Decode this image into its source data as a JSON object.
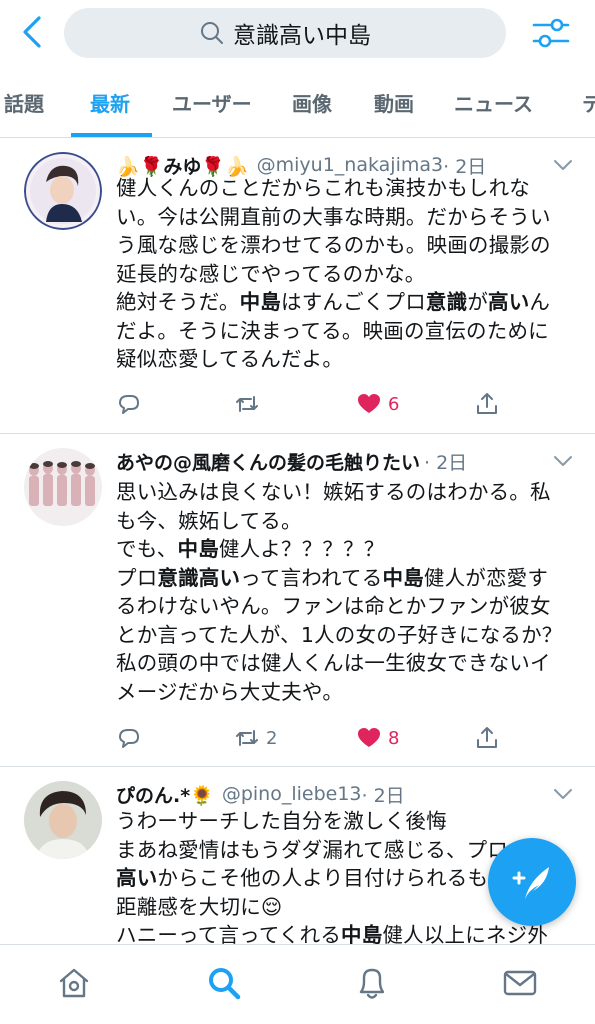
{
  "search": {
    "query": "意識高い中島"
  },
  "tabs": [
    {
      "label": "話題",
      "active": false
    },
    {
      "label": "最新",
      "active": true
    },
    {
      "label": "ユーザー",
      "active": false
    },
    {
      "label": "画像",
      "active": false
    },
    {
      "label": "動画",
      "active": false
    },
    {
      "label": "ニュース",
      "active": false
    },
    {
      "label": "テ",
      "active": false
    }
  ],
  "tweets": [
    {
      "name": "🍌🌹みゆ🌹🍌",
      "handle": "@miyu1_nakajima3",
      "time": "· 2日",
      "lines": [
        [
          "健人くんのことだからこれも演技かもしれな"
        ],
        [
          "い。今は公開直前の大事な時期。だからそうい"
        ],
        [
          "う風な感じを漂わせてるのかも。映画の撮影の"
        ],
        [
          "延長的な感じでやってるのかな。"
        ],
        [
          "絶対そうだ。",
          "中島",
          "はすんごくプロ",
          "意識",
          "が",
          "高い",
          "ん"
        ],
        [
          "だよ。そうに決まってる。映画の宣伝のために"
        ],
        [
          "疑似恋愛してるんだよ。"
        ]
      ],
      "reply_count": "",
      "retweet_count": "",
      "like_count": "6",
      "liked": true
    },
    {
      "name": "あやの@風磨くんの髪の毛触りたい",
      "handle": "",
      "time": "· 2日",
      "lines": [
        [
          "思い込みは良くない！嫉妬するのはわかる。私"
        ],
        [
          "も今、嫉妬してる。"
        ],
        [
          "でも、",
          "中島",
          "健人よ？？？？？"
        ],
        [
          "プロ",
          "意識高い",
          "って言われてる",
          "中島",
          "健人が恋愛す"
        ],
        [
          "るわけないやん。ファンは命とかファンが彼女"
        ],
        [
          "とか言ってた人が、1人の女の子好きになるか？"
        ],
        [
          "私の頭の中では健人くんは一生彼女できないイ"
        ],
        [
          "メージだから大丈夫や。"
        ]
      ],
      "reply_count": "",
      "retweet_count": "2",
      "like_count": "8",
      "liked": true
    },
    {
      "name": "ぴのん.*🌻",
      "handle": "@pino_liebe13",
      "time": "· 2日",
      "lines": [
        [
          "うわーサーチした自分を激しく後悔"
        ],
        [
          "まあね愛情はもうダダ漏れて感じる、プロ"
        ],
        [
          "高い",
          "からこそ他の人より目付けられるも"
        ],
        [
          "距離感を大切に😌"
        ],
        [
          "ハニーって言ってくれる",
          "中島",
          "健人以上にネジ外"
        ]
      ],
      "reply_count": "",
      "retweet_count": "",
      "like_count": "",
      "liked": false
    }
  ],
  "colors": {
    "accent": "#1da1f2",
    "like": "#e0245e",
    "muted": "#657786"
  },
  "bottom_nav": [
    "home-icon",
    "search-icon",
    "notifications-icon",
    "messages-icon"
  ]
}
